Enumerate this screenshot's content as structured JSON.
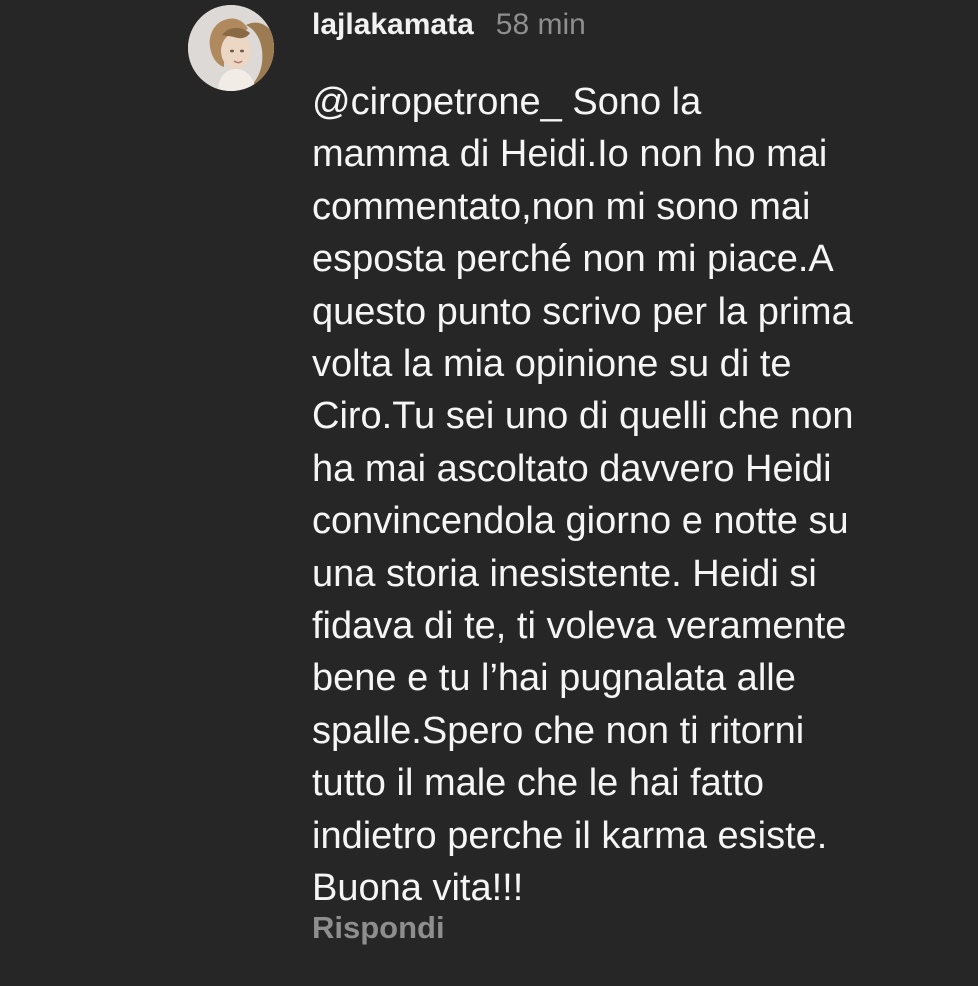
{
  "comment": {
    "avatar_icon": "profile-photo",
    "username": "lajlakamata",
    "time": "58 min",
    "lines": [
      "@ciropetrone_ Sono la",
      "mamma di Heidi.Io non ho mai",
      "commentato,non mi sono mai",
      "esposta perché non mi piace.A",
      "questo punto scrivo per la prima",
      "volta la mia opinione su di te",
      "Ciro.Tu sei uno di quelli che non",
      "ha mai ascoltato davvero Heidi",
      "convincendola giorno e notte su",
      "una storia inesistente. Heidi si",
      "fidava di te, ti voleva veramente",
      "bene e tu l’hai pugnalata alle",
      "spalle.Spero che non ti ritorni",
      "tutto il male che le hai fatto",
      "indietro perche il karma esiste.",
      "Buona vita!!!"
    ],
    "reply_label": "Rispondi"
  },
  "colors": {
    "background": "#262626",
    "text_primary": "#f5f5f5",
    "text_secondary": "#8e8e8e"
  }
}
